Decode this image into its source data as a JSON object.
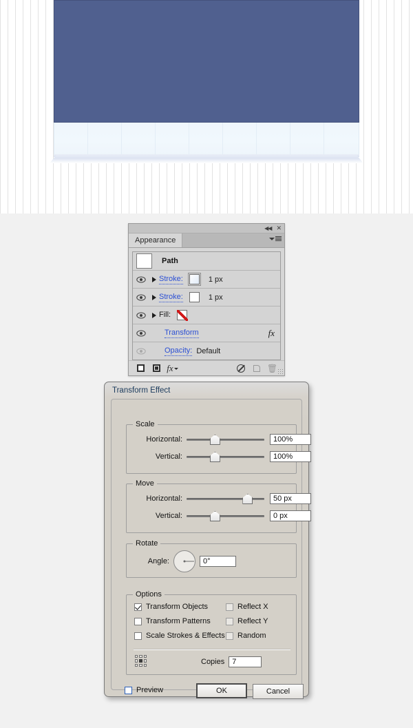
{
  "canvas": {
    "artwork_name": "repeated-rectangle-artwork",
    "blue_fill": "#50608f",
    "blue_stroke": "#44527c",
    "lower_fill": "#eff6fc",
    "segment_count": 9
  },
  "appearance_panel": {
    "tab_label": "Appearance",
    "collapse_icon": "double-chevron-left-icon",
    "close_icon": "close-icon",
    "menu_icon": "panel-menu-icon",
    "object_type": "Path",
    "rows": [
      {
        "label": "Stroke:",
        "value": "1 px",
        "swatch": "gradient",
        "eye": "visible",
        "expandable": true
      },
      {
        "label": "Stroke:",
        "value": "1 px",
        "swatch": "white",
        "eye": "visible",
        "expandable": true
      },
      {
        "label": "Fill:",
        "value": "",
        "swatch": "none",
        "eye": "visible",
        "expandable": true
      },
      {
        "label": "Transform",
        "value": "",
        "swatch": null,
        "eye": "visible",
        "expandable": false,
        "fx": "fx"
      },
      {
        "label": "Opacity:",
        "value": "Default",
        "swatch": null,
        "eye": "dimmed",
        "expandable": false
      }
    ],
    "footer_icons": [
      "add-new-stroke-icon",
      "add-new-fill-icon",
      "add-new-effect-icon",
      "clear-appearance-icon",
      "duplicate-item-icon",
      "delete-item-icon",
      "resize-grip-icon"
    ]
  },
  "dialog": {
    "title": "Transform Effect",
    "scale": {
      "legend": "Scale",
      "horizontal_label": "Horizontal:",
      "horizontal_value": "100%",
      "horizontal_slider_pct": 30,
      "vertical_label": "Vertical:",
      "vertical_value": "100%",
      "vertical_slider_pct": 30
    },
    "move": {
      "legend": "Move",
      "horizontal_label": "Horizontal:",
      "horizontal_value": "50 px",
      "horizontal_slider_pct": 72,
      "vertical_label": "Vertical:",
      "vertical_value": "0 px",
      "vertical_slider_pct": 30
    },
    "rotate": {
      "legend": "Rotate",
      "angle_label": "Angle:",
      "angle_value": "0°",
      "dial_icon": "angle-dial-icon"
    },
    "options": {
      "legend": "Options",
      "checkboxes": [
        {
          "label": "Transform Objects",
          "checked": true,
          "enabled": true
        },
        {
          "label": "Transform Patterns",
          "checked": false,
          "enabled": true
        },
        {
          "label": "Scale Strokes & Effects",
          "checked": false,
          "enabled": true
        },
        {
          "label": "Reflect X",
          "checked": false,
          "enabled": false
        },
        {
          "label": "Reflect Y",
          "checked": false,
          "enabled": false
        },
        {
          "label": "Random",
          "checked": false,
          "enabled": false
        }
      ],
      "anchor_icon": "anchor-point-grid-icon",
      "anchor_selected": "center",
      "copies_label": "Copies",
      "copies_value": "7"
    },
    "footer": {
      "preview_label": "Preview",
      "preview_checked": false,
      "ok_label": "OK",
      "cancel_label": "Cancel"
    }
  }
}
